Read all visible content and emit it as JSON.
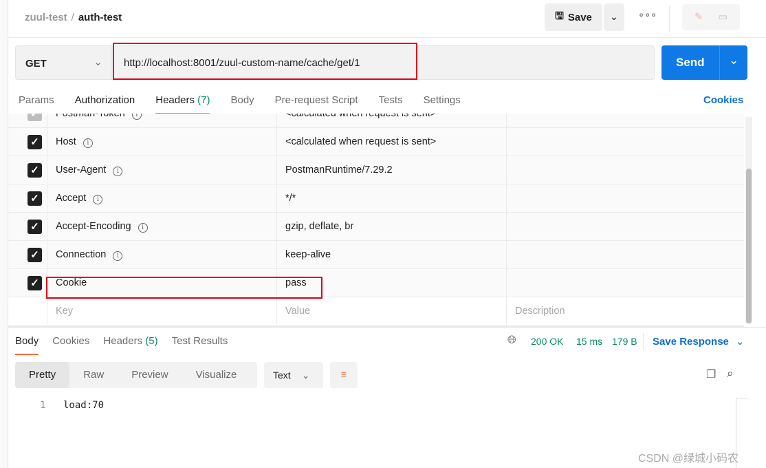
{
  "breadcrumb": {
    "collection": "zuul-test",
    "request": "auth-test"
  },
  "toolbar": {
    "save_label": "Save"
  },
  "request": {
    "method": "GET",
    "url": "http://localhost:8001/zuul-custom-name/cache/get/1",
    "send_label": "Send"
  },
  "tabs": [
    {
      "label": "Params"
    },
    {
      "label": "Authorization"
    },
    {
      "label": "Headers",
      "count": "(7)"
    },
    {
      "label": "Body"
    },
    {
      "label": "Pre-request Script"
    },
    {
      "label": "Tests"
    },
    {
      "label": "Settings"
    }
  ],
  "cookies_label": "Cookies",
  "headers": [
    {
      "key": "Postman-Token",
      "value": "<calculated when request is sent>",
      "info": true,
      "disabled": true
    },
    {
      "key": "Host",
      "value": "<calculated when request is sent>",
      "info": true
    },
    {
      "key": "User-Agent",
      "value": "PostmanRuntime/7.29.2",
      "info": true
    },
    {
      "key": "Accept",
      "value": "*/*",
      "info": true
    },
    {
      "key": "Accept-Encoding",
      "value": "gzip, deflate, br",
      "info": true
    },
    {
      "key": "Connection",
      "value": "keep-alive",
      "info": true
    },
    {
      "key": "Cookie",
      "value": "pass",
      "info": false
    }
  ],
  "placeholders": {
    "key": "Key",
    "value": "Value",
    "description": "Description"
  },
  "response": {
    "tabs": [
      {
        "label": "Body"
      },
      {
        "label": "Cookies"
      },
      {
        "label": "Headers",
        "count": "(5)"
      },
      {
        "label": "Test Results"
      }
    ],
    "status": "200 OK",
    "time": "15 ms",
    "size": "179 B",
    "save_label": "Save Response",
    "views": [
      "Pretty",
      "Raw",
      "Preview",
      "Visualize"
    ],
    "format": "Text",
    "lines": [
      {
        "n": "1",
        "text": "load:70"
      }
    ]
  },
  "watermark": "CSDN @绿城小码农",
  "colors": {
    "accent": "#ff6c37",
    "send": "#0f7ae5",
    "status": "#0a8a5c",
    "highlight": "#e0001b"
  }
}
